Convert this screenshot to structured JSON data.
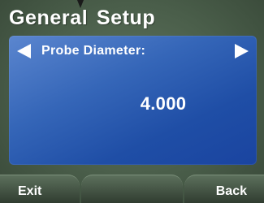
{
  "screen": {
    "title": "General Setup"
  },
  "setting": {
    "label": "Probe Diameter:",
    "value": "4.000",
    "prev_icon": "arrow-left-icon",
    "next_icon": "arrow-right-icon"
  },
  "softkeys": {
    "left_label": "Exit",
    "middle_label": "",
    "right_label": "Back"
  },
  "colors": {
    "panel": "#1f4ea6",
    "background": "#4a5e4a",
    "text": "#ffffff"
  }
}
